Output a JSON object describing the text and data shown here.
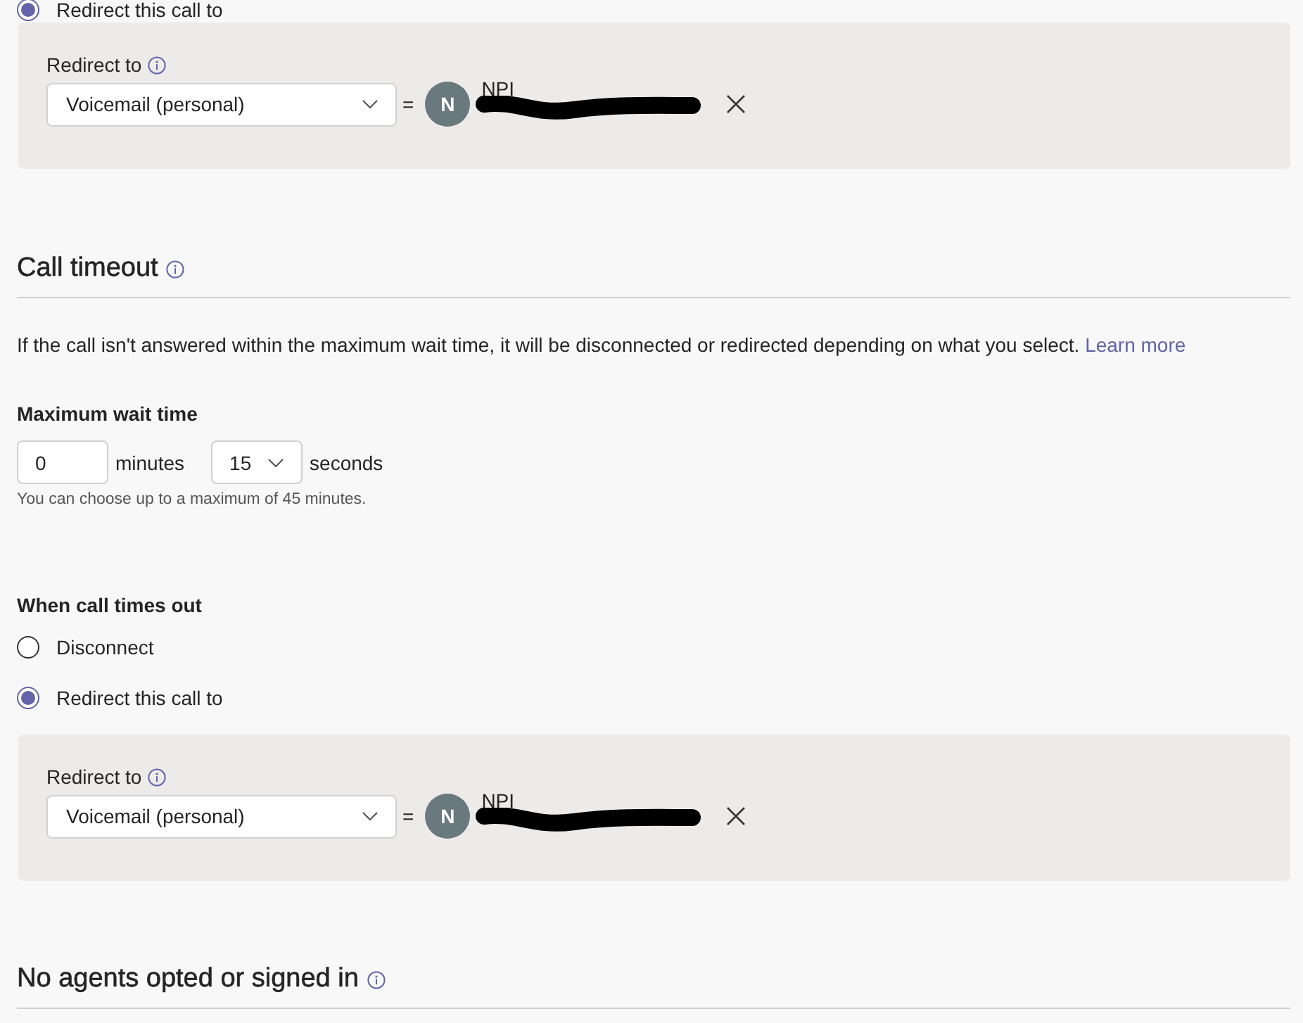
{
  "top_options": [
    {
      "label": "Redirect this call to",
      "selected": true
    }
  ],
  "top_redirect": {
    "label": "Redirect to",
    "target": "Voicemail (personal)",
    "equals": "=",
    "avatar_initial": "N",
    "name": "NPI"
  },
  "call_timeout": {
    "title": "Call timeout",
    "description": "If the call isn't answered within the maximum wait time, it will be disconnected or redirected depending on what you select.",
    "link": "Learn more",
    "wait_label": "Maximum wait time",
    "minutes_value": "0",
    "minutes_unit": "minutes",
    "seconds_value": "15",
    "seconds_unit": "seconds",
    "hint": "You can choose up to a maximum of 45 minutes.",
    "timeout_label": "When call times out",
    "options": [
      {
        "label": "Disconnect",
        "selected": false
      },
      {
        "label": "Redirect this call to",
        "selected": true
      }
    ],
    "redirect": {
      "label": "Redirect to",
      "target": "Voicemail (personal)",
      "equals": "=",
      "avatar_initial": "N",
      "name": "NPI"
    }
  },
  "next_section": {
    "title": "No agents opted or signed in"
  }
}
